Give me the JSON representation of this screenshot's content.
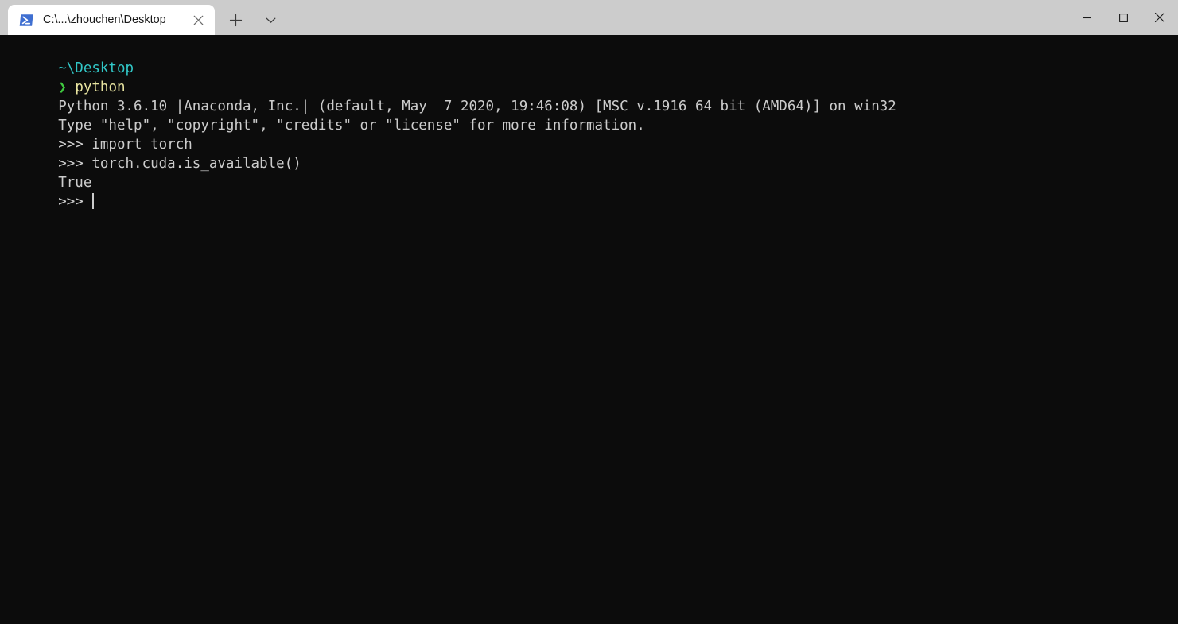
{
  "window": {
    "titlebar_bg": "#cccccc",
    "terminal_bg": "#0c0c0c",
    "tab": {
      "icon_name": "powershell-icon",
      "title": "C:\\...\\zhouchen\\Desktop",
      "close_label": "✕"
    },
    "new_tab_label": "+",
    "dropdown_label": "⌄",
    "controls": {
      "minimize_label": "—",
      "maximize_label": "□",
      "close_label": "✕"
    }
  },
  "terminal": {
    "colors": {
      "foreground": "#cccccc",
      "background": "#0c0c0c",
      "path": "#31c7c7",
      "chevron": "#3fc93f",
      "command": "#e8e4a0"
    },
    "prompt": {
      "path": "~\\Desktop",
      "chevron": "❯",
      "command": "python"
    },
    "lines": [
      "Python 3.6.10 |Anaconda, Inc.| (default, May  7 2020, 19:46:08) [MSC v.1916 64 bit (AMD64)] on win32",
      "Type \"help\", \"copyright\", \"credits\" or \"license\" for more information.",
      ">>> import torch",
      ">>> torch.cuda.is_available()",
      "True"
    ],
    "final_prompt": ">>> "
  }
}
